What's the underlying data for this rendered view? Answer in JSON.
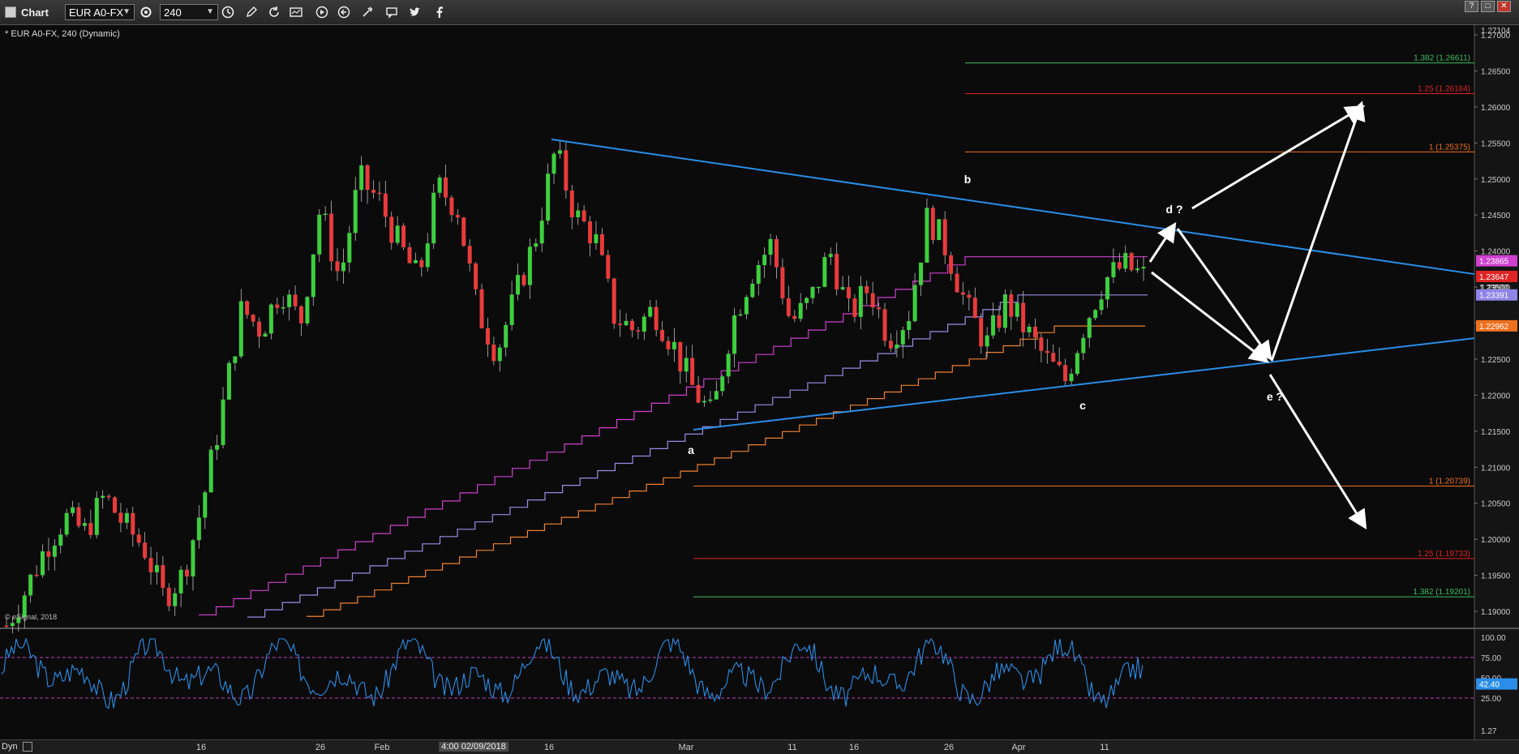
{
  "window": {
    "title": "Chart",
    "symbol": "EUR A0-FX",
    "interval": "240",
    "buttons": [
      "?",
      "□",
      "✕"
    ]
  },
  "toolbar": {
    "icons": [
      "settings-gear-icon",
      "clock-icon",
      "pencil-icon",
      "refresh-icon",
      "chart-type-icon",
      "play-icon",
      "replay-icon",
      "tools-icon",
      "comment-icon",
      "twitter-icon",
      "facebook-icon"
    ]
  },
  "chart_header": "* EUR A0-FX, 240 (Dynamic)",
  "copyright": "© eSignal, 2018",
  "status_bar": {
    "label": "Dyn"
  },
  "colors": {
    "background": "#0b0b0b",
    "up_candle": "#3ecf3e",
    "down_candle": "#e83b3b",
    "trendline": "#2a8ee8",
    "arrows": "#ffffff",
    "oscillator": "#2a8ee8",
    "oscillator_levels": "#c040c0",
    "ma_magenta": "#d040d0",
    "ma_purple": "#9a8ce8",
    "ma_orange": "#f08030"
  },
  "chart_data": {
    "type": "line",
    "title": "* EUR A0-FX, 240 (Dynamic)",
    "xlabel": "",
    "ylabel": "",
    "ylim": [
      1.187,
      1.271
    ],
    "x": [
      "16",
      "26",
      "Feb",
      "4:00 02/09/2018",
      "16",
      "Mar",
      "11",
      "16",
      "26",
      "Apr",
      "11"
    ],
    "y_ticks": [
      "1.19000",
      "1.19500",
      "1.20000",
      "1.20500",
      "1.21000",
      "1.21500",
      "1.22000",
      "1.22500",
      "1.23000",
      "1.23500",
      "1.24000",
      "1.24500",
      "1.25000",
      "1.25500",
      "1.26000",
      "1.26500",
      "1.27000"
    ],
    "y_top_label": "1.27104",
    "series": [
      {
        "values": [
          1.188,
          1.193,
          1.199,
          1.203,
          1.201,
          1.206,
          1.202,
          1.199,
          1.192,
          1.195,
          1.205,
          1.218,
          1.232,
          1.229,
          1.235,
          1.23,
          1.246,
          1.236,
          1.25,
          1.247,
          1.241,
          1.236,
          1.249,
          1.246,
          1.232,
          1.226,
          1.234,
          1.242,
          1.254,
          1.245,
          1.242,
          1.231,
          1.229,
          1.232,
          1.227,
          1.221,
          1.217,
          1.23,
          1.237,
          1.241,
          1.23,
          1.233,
          1.24,
          1.231,
          1.235,
          1.228,
          1.231,
          1.245,
          1.24,
          1.232,
          1.227,
          1.233,
          1.229,
          1.225,
          1.222,
          1.23,
          1.236,
          1.238,
          1.2365
        ]
      }
    ],
    "price_labels": [
      "1.23865",
      "1.23647",
      "1.23500",
      "1.23391",
      "1.22962"
    ],
    "fib_levels_upper": [
      "1.382 (1.26611)",
      "1.25 (1.26184)",
      "1 (1.25375)"
    ],
    "fib_levels_lower": [
      "1 (1.20739)",
      "1.25 (1.19733)",
      "1.382 (1.19201)"
    ],
    "wave_labels": [
      "a",
      "b",
      "c",
      "d ?",
      "e ?"
    ],
    "oscillator": {
      "levels": [
        75,
        25
      ],
      "y_ticks": [
        "100.00",
        "75.00",
        "50.00",
        "25.00"
      ],
      "bottom_label": "1.27",
      "current_label": "42.40"
    }
  }
}
